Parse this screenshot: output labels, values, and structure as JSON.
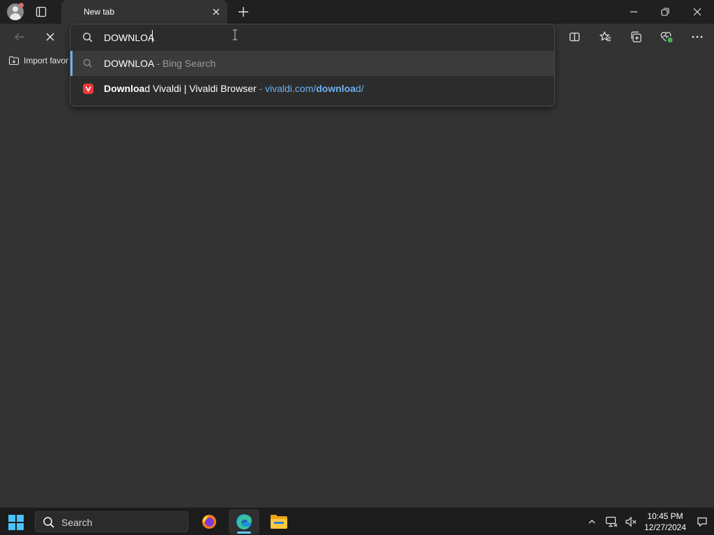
{
  "browser": {
    "tab": {
      "title": "New tab"
    },
    "favorites_bar": {
      "import_label": "Import favor"
    }
  },
  "omnibox": {
    "value": "DOWNLOA",
    "suggestions": [
      {
        "query": "DOWNLOA",
        "suffix": " - Bing Search",
        "icon": "search-icon"
      },
      {
        "title_bold": "Downloa",
        "title_rest": "d Vivaldi | Vivaldi Browser",
        "separator": " - ",
        "url_prefix": "vivaldi.com/",
        "url_bold": "downloa",
        "url_suffix": "d/",
        "icon": "vivaldi-icon"
      }
    ]
  },
  "taskbar": {
    "search_label": "Search",
    "time": "10:45 PM",
    "date": "12/27/2024",
    "apps": [
      "firefox-icon",
      "edge-icon",
      "file-explorer-icon"
    ]
  },
  "colors": {
    "accent": "#6fb1f0",
    "background": "#333333",
    "titlebar": "#202020",
    "taskbar": "#1c1c1c",
    "vivaldi": "#ef3939"
  }
}
